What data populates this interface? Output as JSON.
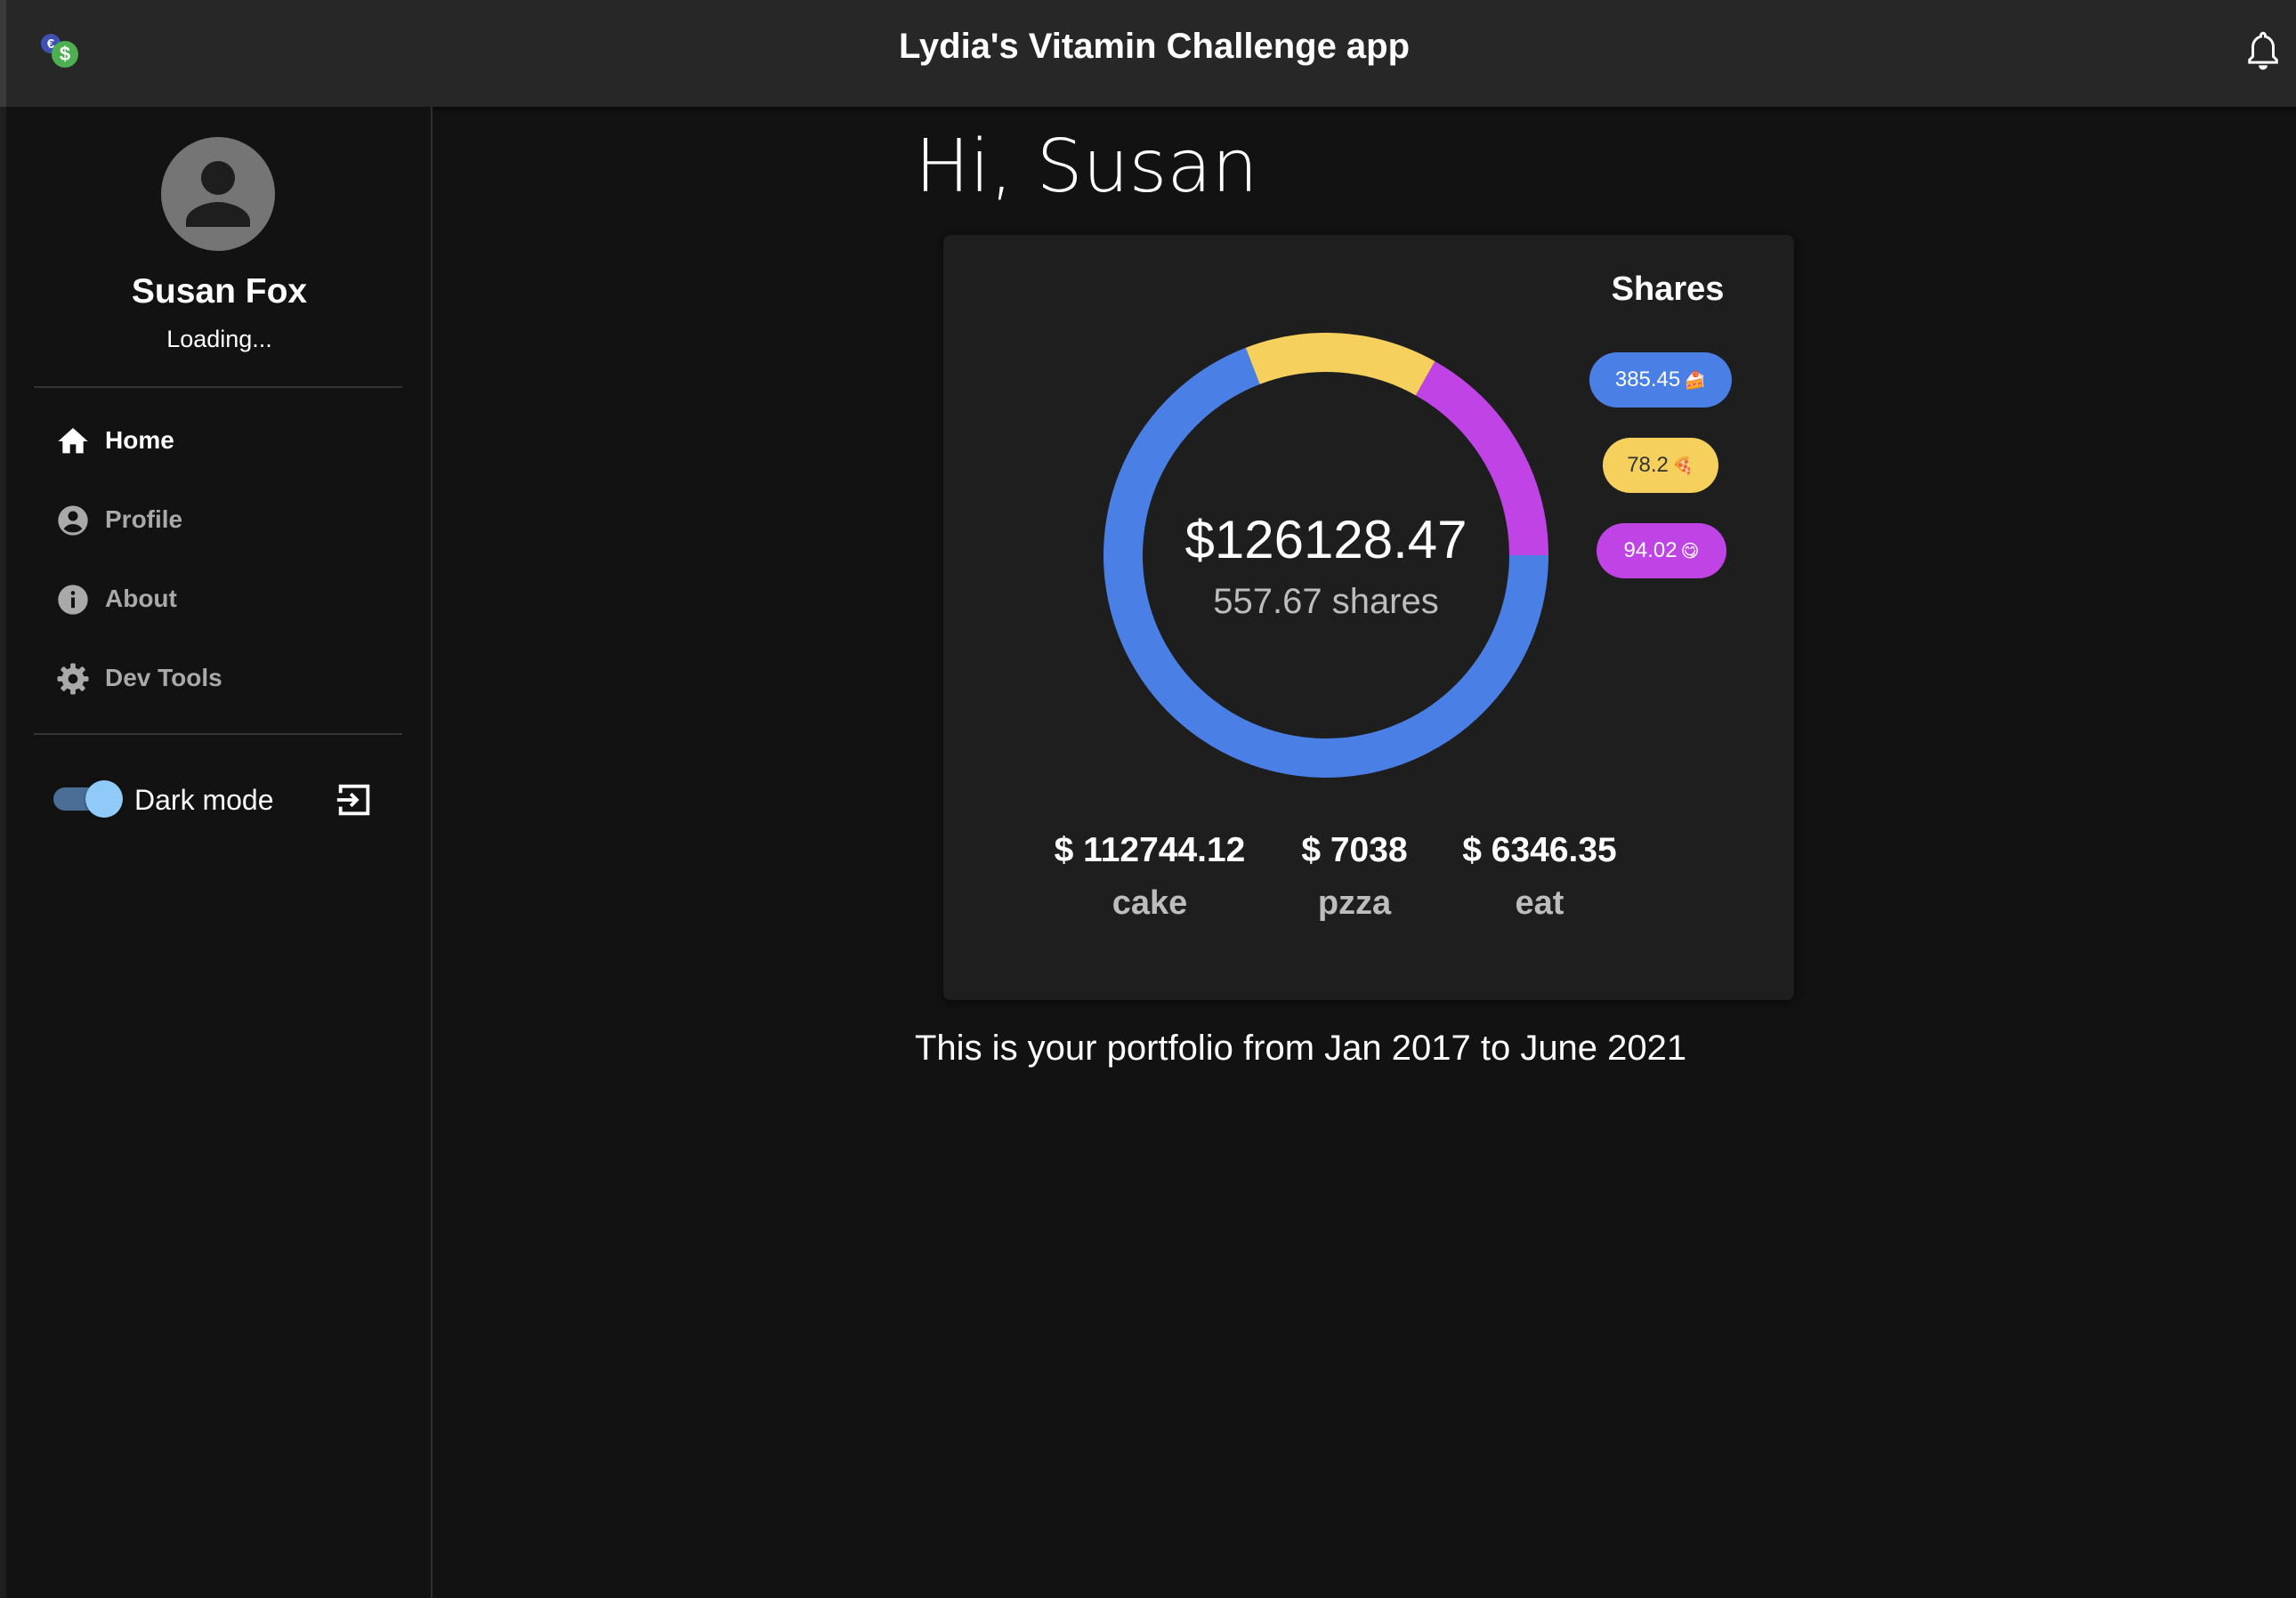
{
  "header": {
    "title": "Lydia's Vitamin Challenge app",
    "logo_icon": "dollar-coin-icon",
    "notifications_icon": "bell-icon"
  },
  "sidebar": {
    "user_name": "Susan Fox",
    "user_status": "Loading...",
    "nav": [
      {
        "label": "Home",
        "icon": "home-icon",
        "active": true
      },
      {
        "label": "Profile",
        "icon": "account-circle-icon",
        "active": false
      },
      {
        "label": "About",
        "icon": "info-icon",
        "active": false
      },
      {
        "label": "Dev Tools",
        "icon": "gear-icon",
        "active": false
      }
    ],
    "dark_mode_label": "Dark mode",
    "dark_mode_on": true,
    "logout_icon": "exit-icon"
  },
  "main": {
    "greeting": "Hi, Susan",
    "total_value": "$126128.47",
    "total_shares": "557.67 shares",
    "shares_title": "Shares",
    "chips": [
      {
        "label": "385.45",
        "emoji": "🍰",
        "color": "#4a80e6",
        "text_color": "#ffffff"
      },
      {
        "label": "78.2",
        "emoji": "🍕",
        "color": "#f5d05c",
        "text_color": "#333333"
      },
      {
        "label": "94.02",
        "emoji": "😋",
        "color": "#c043e6",
        "text_color": "#ffffff"
      }
    ],
    "values": [
      {
        "amount": "$ 112744.12",
        "name": "cake"
      },
      {
        "amount": "$ 7038",
        "name": "pzza"
      },
      {
        "amount": "$ 6346.35",
        "name": "eat"
      }
    ],
    "portfolio_text": "This is your portfolio from Jan 2017 to June 2021"
  },
  "chart_data": {
    "type": "pie",
    "categories": [
      "cake",
      "pzza",
      "eat"
    ],
    "values": [
      385.45,
      78.2,
      94.02
    ],
    "colors": [
      "#4a80e6",
      "#f5d05c",
      "#c043e6"
    ],
    "title": "",
    "style": "donut"
  },
  "colors": {
    "background": "#121212",
    "appbar": "#272727",
    "card": "#1e1e1e",
    "toggle_thumb": "#90caf9"
  }
}
